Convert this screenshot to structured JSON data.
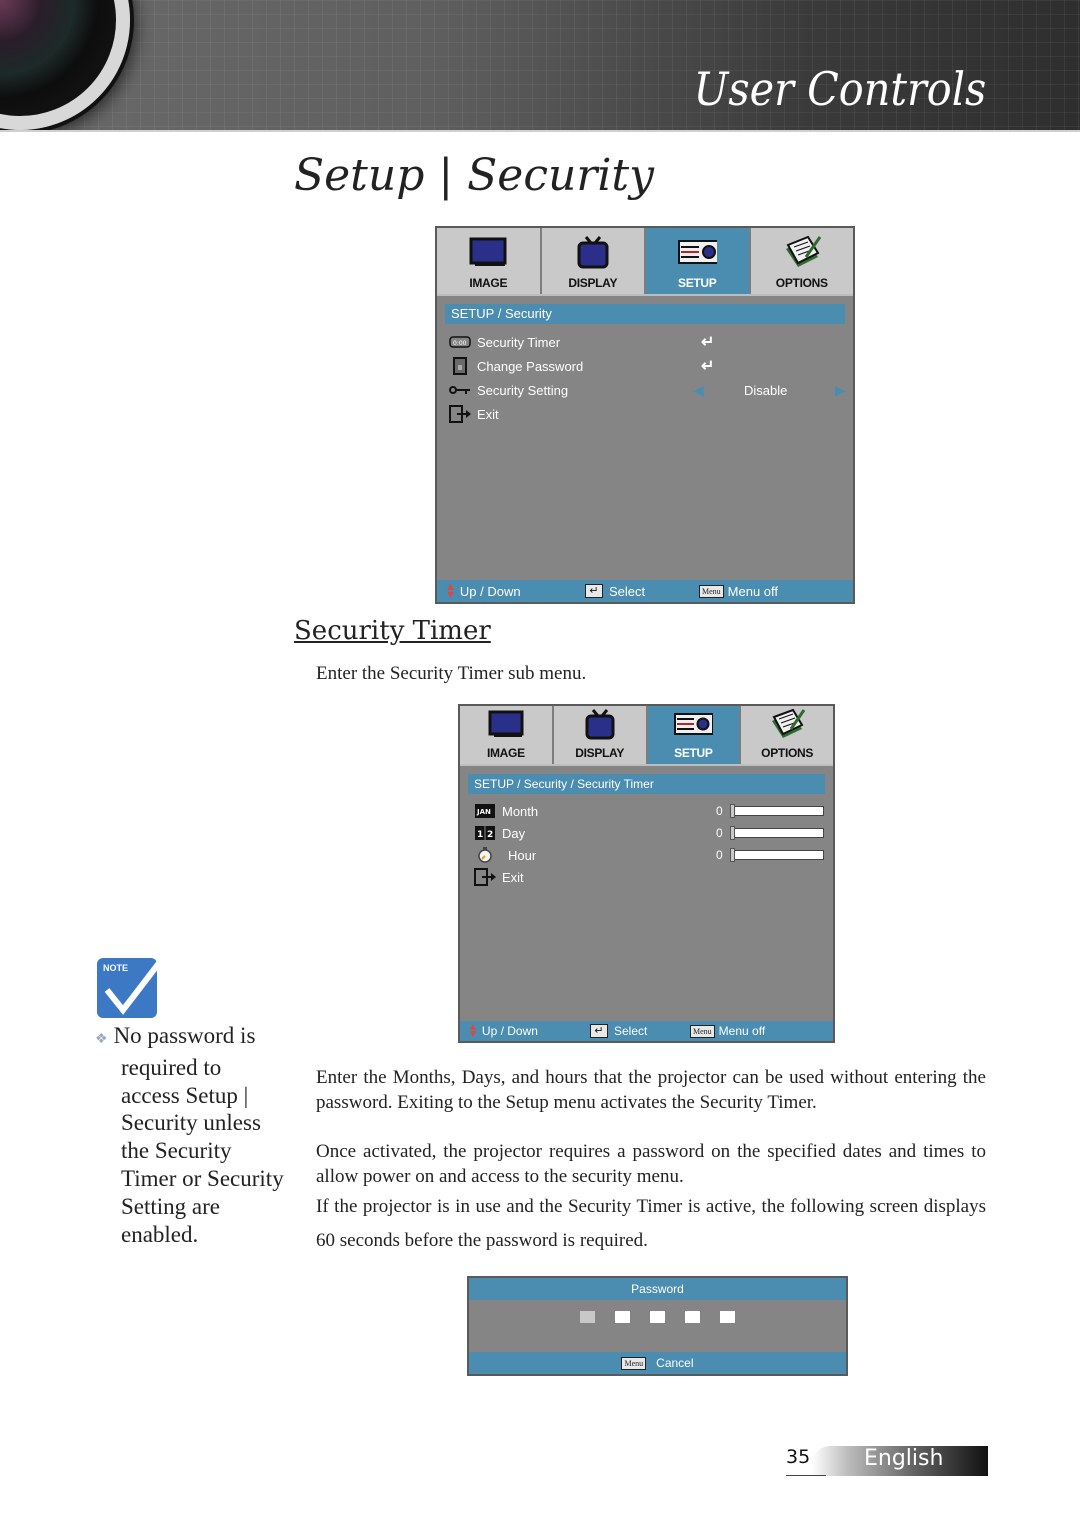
{
  "header": {
    "section_title": "User Controls"
  },
  "page": {
    "title": "Setup | Security",
    "number": "35",
    "language": "English"
  },
  "osd_main": {
    "tabs": [
      {
        "label": "IMAGE",
        "icon": "monitor-icon",
        "active": false
      },
      {
        "label": "DISPLAY",
        "icon": "tv-icon",
        "active": false
      },
      {
        "label": "SETUP",
        "icon": "projector-icon",
        "active": true
      },
      {
        "label": "OPTIONS",
        "icon": "notepad-icon",
        "active": false
      }
    ],
    "breadcrumb": "SETUP / Security",
    "items": [
      {
        "label": "Security Timer",
        "icon": "timer-icon",
        "control": "enter-icon"
      },
      {
        "label": "Change Password",
        "icon": "password-icon",
        "control": "enter-icon"
      },
      {
        "label": "Security Setting",
        "icon": "key-icon",
        "value": "Disable"
      },
      {
        "label": "Exit",
        "icon": "exit-icon"
      }
    ],
    "footer": {
      "updown": "Up / Down",
      "select": "Select",
      "menu_key": "Menu",
      "menu_off": "Menu off"
    }
  },
  "section": {
    "title": "Security Timer",
    "intro": "Enter the Security Timer sub menu."
  },
  "osd_timer": {
    "tabs": [
      {
        "label": "IMAGE",
        "active": false
      },
      {
        "label": "DISPLAY",
        "active": false
      },
      {
        "label": "SETUP",
        "active": true
      },
      {
        "label": "OPTIONS",
        "active": false
      }
    ],
    "breadcrumb": "SETUP / Security / Security Timer",
    "items": [
      {
        "label": "Month",
        "icon": "calendar-jan-icon",
        "value": "0",
        "fraction": 0
      },
      {
        "label": "Day",
        "icon": "day-12-icon",
        "value": "0",
        "fraction": 0
      },
      {
        "label": "Hour",
        "icon": "clock-icon",
        "value": "0",
        "fraction": 0
      },
      {
        "label": "Exit",
        "icon": "exit-icon"
      }
    ],
    "footer": {
      "updown": "Up / Down",
      "select": "Select",
      "menu_key": "Menu",
      "menu_off": "Menu off"
    }
  },
  "note": {
    "label": "NOTE",
    "text": "No password is required to access Setup | Security unless the Security Timer or Security Setting are enabled."
  },
  "body": {
    "p1": "Enter the Months, Days, and hours that the projector can be used without entering the password. Exiting to the Setup menu activates the Security Timer.",
    "p2": "Once activated, the projector requires a password on the specified dates and times to allow power on and access to the security menu.",
    "p3": "If the projector is in use and the Security Timer is active, the following screen displays 60 seconds before the password is required."
  },
  "password_dialog": {
    "title": "Password",
    "digits": 5,
    "menu_key": "Menu",
    "cancel": "Cancel"
  },
  "colors": {
    "osd_accent": "#4a8db0",
    "osd_bg": "#858585",
    "note_blue": "#3c78c4"
  }
}
